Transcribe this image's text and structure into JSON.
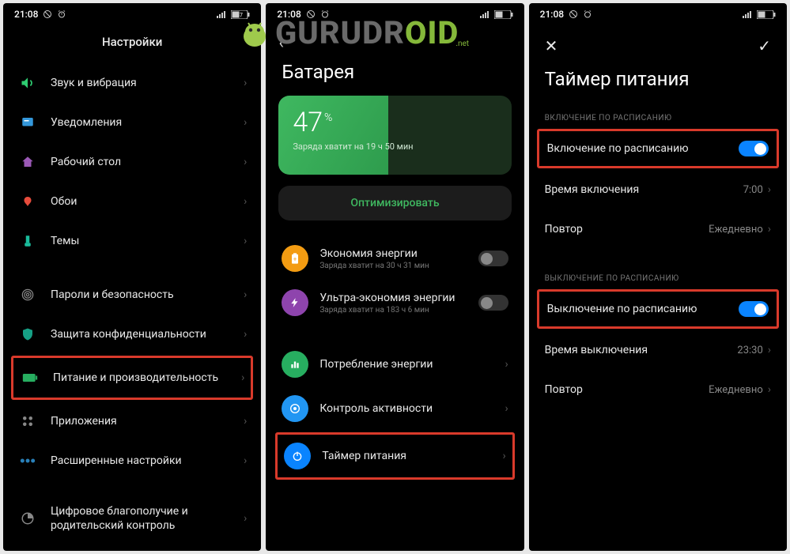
{
  "status": {
    "time": "21:08",
    "battery_pct": "47"
  },
  "watermark": {
    "text_a": "GURUDR",
    "text_b": "OID",
    "suffix": ".net"
  },
  "screen1": {
    "title": "Настройки",
    "items": [
      {
        "label": "Звук и вибрация"
      },
      {
        "label": "Уведомления"
      },
      {
        "label": "Рабочий стол"
      },
      {
        "label": "Обои"
      },
      {
        "label": "Темы"
      },
      {
        "label": "Пароли и безопасность"
      },
      {
        "label": "Защита конфиденциальности"
      },
      {
        "label": "Питание и производительность"
      },
      {
        "label": "Приложения"
      },
      {
        "label": "Расширенные настройки"
      },
      {
        "label": "Цифровое благополучие и родительский контроль"
      }
    ]
  },
  "screen2": {
    "title": "Батарея",
    "pct": "47",
    "pct_sign": "%",
    "remaining": "Заряда хватит на 19 ч 50 мин",
    "optimize": "Оптимизировать",
    "items": [
      {
        "title": "Экономия энергии",
        "sub": "Заряда хватит на 30 ч 31 мин"
      },
      {
        "title": "Ультра-экономия энергии",
        "sub": "Заряда хватит на 183 ч 6 мин"
      },
      {
        "title": "Потребление энергии"
      },
      {
        "title": "Контроль активности"
      },
      {
        "title": "Таймер питания"
      }
    ]
  },
  "screen3": {
    "title": "Таймер питания",
    "section_on": "ВКЛЮЧЕНИЕ ПО РАСПИСАНИЮ",
    "row_on_toggle": "Включение по расписанию",
    "row_on_time_label": "Время включения",
    "row_on_time_value": "7:00",
    "row_on_repeat_label": "Повтор",
    "row_on_repeat_value": "Ежедневно",
    "section_off": "ВЫКЛЮЧЕНИЕ ПО РАСПИСАНИЮ",
    "row_off_toggle": "Выключение по расписанию",
    "row_off_time_label": "Время выключения",
    "row_off_time_value": "23:30",
    "row_off_repeat_label": "Повтор",
    "row_off_repeat_value": "Ежедневно"
  }
}
